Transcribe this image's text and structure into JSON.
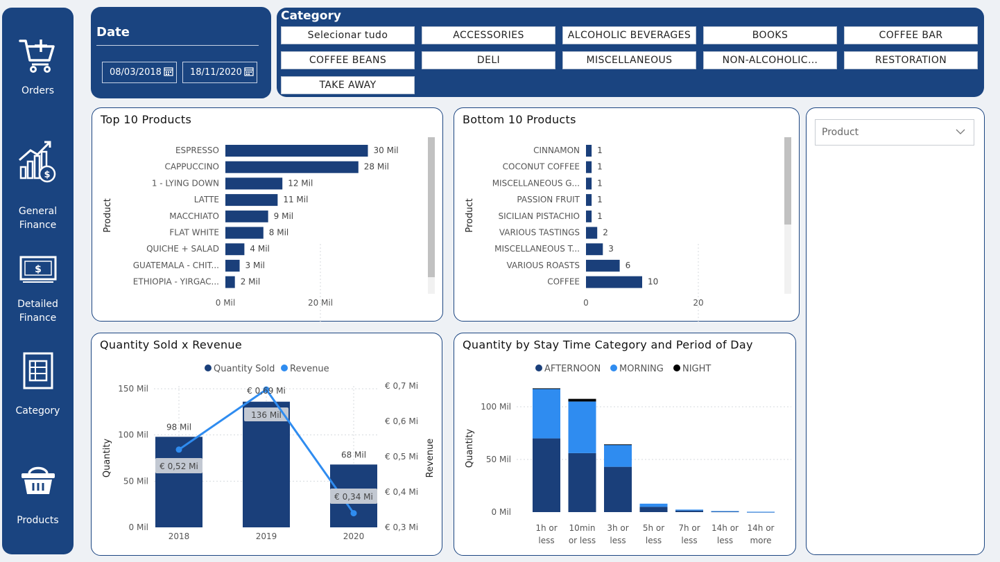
{
  "sidebar": {
    "items": [
      {
        "label": "Orders",
        "icon": "cart-plus-icon"
      },
      {
        "label": "General Finance",
        "icon": "finance-chart-icon"
      },
      {
        "label": "Detailed Finance",
        "icon": "money-bill-icon"
      },
      {
        "label": "Category",
        "icon": "category-sheet-icon"
      },
      {
        "label": "Products",
        "icon": "basket-icon"
      }
    ]
  },
  "date_filter": {
    "title": "Date",
    "start": "08/03/2018",
    "end": "18/11/2020"
  },
  "category_filter": {
    "title": "Category",
    "options": [
      "Selecionar tudo",
      "ACCESSORIES",
      "ALCOHOLIC BEVERAGES",
      "BOOKS",
      "COFFEE BAR",
      "COFFEE BEANS",
      "DELI",
      "MISCELLANEOUS",
      "NON-ALCOHOLIC…",
      "RESTORATION",
      "TAKE AWAY"
    ]
  },
  "product_slicer": {
    "placeholder": "Product"
  },
  "colors": {
    "navy": "#1a4480",
    "bar": "#1a3f7a",
    "light_blue": "#2f8cf0",
    "night": "#000000"
  },
  "top10": {
    "title": "Top 10 Products",
    "chart_data": {
      "type": "bar",
      "orientation": "horizontal",
      "ylabel": "Product",
      "categories": [
        "ESPRESSO",
        "CAPPUCCINO",
        "1 - LYING DOWN",
        "LATTE",
        "MACCHIATO",
        "FLAT WHITE",
        "QUICHE + SALAD",
        "GUATEMALA - CHIT...",
        "ETHIOPIA - YIRGAC..."
      ],
      "values": [
        30000,
        28000,
        12000,
        11000,
        9000,
        8000,
        4000,
        3000,
        2000
      ],
      "value_labels": [
        "30 Mil",
        "28 Mil",
        "12 Mil",
        "11 Mil",
        "9 Mil",
        "8 Mil",
        "4 Mil",
        "3 Mil",
        "2 Mil"
      ],
      "xticks": [
        0,
        20000
      ],
      "xtick_labels": [
        "0 Mil",
        "20 Mil"
      ]
    }
  },
  "bottom10": {
    "title": "Bottom 10 Products",
    "chart_data": {
      "type": "bar",
      "orientation": "horizontal",
      "ylabel": "Product",
      "categories": [
        "CINNAMON",
        "COCONUT COFFEE",
        "MISCELLANEOUS G...",
        "PASSION FRUIT",
        "SICILIAN PISTACHIO",
        "VARIOUS TASTINGS",
        "MISCELLANEOUS T...",
        "VARIOUS ROASTS",
        "COFFEE"
      ],
      "values": [
        1,
        1,
        1,
        1,
        1,
        2,
        3,
        6,
        10
      ],
      "value_labels": [
        "1",
        "1",
        "1",
        "1",
        "1",
        "2",
        "3",
        "6",
        "10"
      ],
      "xticks": [
        0,
        20
      ],
      "xtick_labels": [
        "0",
        "20"
      ]
    }
  },
  "qty_revenue": {
    "title": "Quantity Sold x Revenue",
    "chart_data": {
      "type": "bar",
      "categories": [
        "2018",
        "2019",
        "2020"
      ],
      "series": [
        {
          "name": "Quantity Sold",
          "type": "bar",
          "values": [
            98000,
            136000,
            68000
          ],
          "labels": [
            "98 Mil",
            "136 Mil",
            "68 Mil"
          ]
        },
        {
          "name": "Revenue",
          "type": "line",
          "values": [
            0.52,
            0.69,
            0.34
          ],
          "labels": [
            "€ 0,52 Mi",
            "€ 0,69 Mi",
            "€ 0,34 Mi"
          ]
        }
      ],
      "ylabel": "Quantity",
      "y2label": "Revenue",
      "ylim": [
        0,
        150000
      ],
      "yticks": [
        0,
        50000,
        100000,
        150000
      ],
      "ytick_labels": [
        "0 Mil",
        "50 Mil",
        "100 Mil",
        "150 Mil"
      ],
      "y2lim": [
        0.3,
        0.7
      ],
      "y2ticks": [
        0.3,
        0.4,
        0.5,
        0.6,
        0.7
      ],
      "y2tick_labels": [
        "€ 0,3 Mi",
        "€ 0,4 Mi",
        "€ 0,5 Mi",
        "€ 0,6 Mi",
        "€ 0,7 Mi"
      ],
      "legend": "top-center"
    }
  },
  "stay_time": {
    "title": "Quantity by Stay Time Category and Period of Day",
    "chart_data": {
      "type": "bar",
      "stacked": true,
      "categories": [
        "1h or less",
        "10min or less",
        "3h or less",
        "5h or less",
        "7h or less",
        "14h or less",
        "14h or more"
      ],
      "category_lines": [
        [
          "1h or",
          "less"
        ],
        [
          "10min",
          "or less"
        ],
        [
          "3h or",
          "less"
        ],
        [
          "5h or",
          "less"
        ],
        [
          "7h or",
          "less"
        ],
        [
          "14h or",
          "less"
        ],
        [
          "14h or",
          "more"
        ]
      ],
      "series": [
        {
          "name": "AFTERNOON",
          "values": [
            70000,
            56000,
            43000,
            5000,
            1500,
            600,
            200
          ]
        },
        {
          "name": "MORNING",
          "values": [
            47000,
            49000,
            21000,
            3000,
            900,
            400,
            150
          ]
        },
        {
          "name": "NIGHT",
          "values": [
            500,
            2500,
            300,
            0,
            0,
            0,
            0
          ]
        }
      ],
      "ylabel": "Quantity",
      "ylim": [
        0,
        120000
      ],
      "yticks": [
        0,
        50000,
        100000
      ],
      "ytick_labels": [
        "0 Mil",
        "50 Mil",
        "100 Mil"
      ],
      "legend": "top-left"
    }
  }
}
